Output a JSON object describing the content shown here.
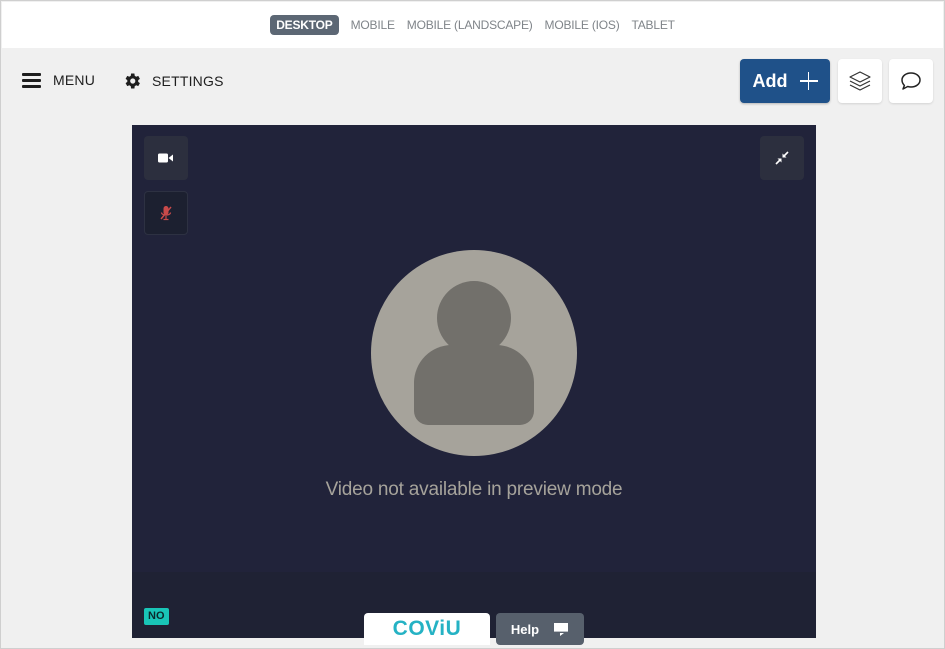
{
  "device_bar": {
    "tabs": [
      {
        "label": "DESKTOP",
        "active": true
      },
      {
        "label": "MOBILE",
        "active": false
      },
      {
        "label": "MOBILE (LANDSCAPE)",
        "active": false
      },
      {
        "label": "MOBILE (IOS)",
        "active": false
      },
      {
        "label": "TABLET",
        "active": false
      }
    ]
  },
  "toolbar": {
    "menu_label": "MENU",
    "settings_label": "SETTINGS",
    "add_label": "Add",
    "icons": [
      "hamburger-icon",
      "gear-icon",
      "plus-icon",
      "layers-icon",
      "comment-icon"
    ]
  },
  "video": {
    "message": "Video not available in preview mode",
    "badge": "NO",
    "controls": [
      "camera-icon",
      "mic-muted-icon",
      "minimize-icon"
    ]
  },
  "footer": {
    "logo_text": "COViU",
    "help_label": "Help"
  },
  "colors": {
    "accent": "#1f5189",
    "video_bg": "#21233a",
    "avatar": "#a6a39b",
    "teal": "#25b2c4",
    "badge": "#19c5b7",
    "mic_muted": "#c94a4a"
  }
}
